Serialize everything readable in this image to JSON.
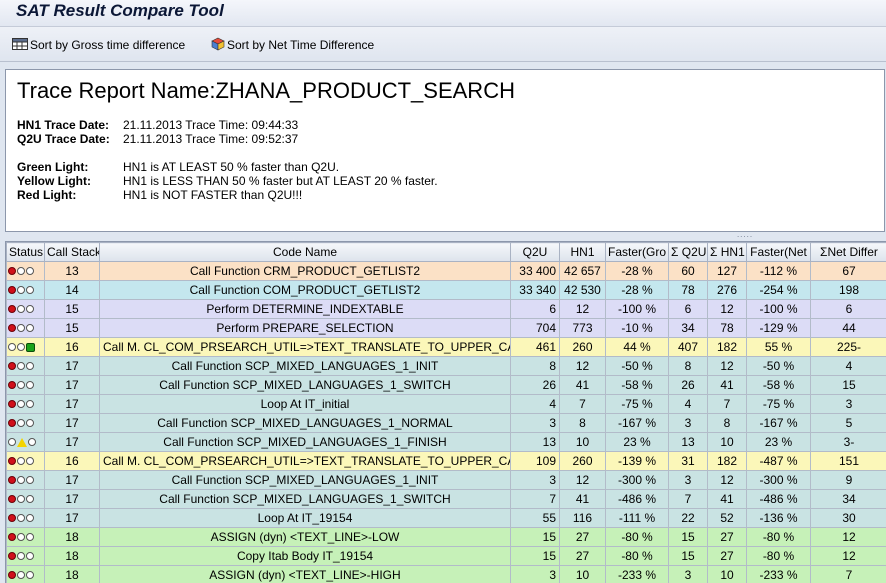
{
  "window": {
    "title": "SAT Result Compare Tool"
  },
  "toolbar": {
    "sort_gross_label": "Sort by Gross time difference",
    "sort_net_label": "Sort by Net Time Difference"
  },
  "report": {
    "name_line": "Trace Report Name:ZHANA_PRODUCT_SEARCH",
    "hn1_label": "HN1 Trace Date:",
    "hn1_value": "21.11.2013 Trace Time: 09:44:33",
    "q2u_label": "Q2U Trace Date:",
    "q2u_value": "21.11.2013 Trace Time: 09:52:37",
    "green_label": "Green Light:",
    "green_text": "HN1 is AT LEAST 50 % faster than Q2U.",
    "yellow_label": "Yellow Light:",
    "yellow_text": "HN1 is LESS THAN 50 % faster but AT LEAST 20 % faster.",
    "red_label": "Red Light:",
    "red_text": "HN1 is NOT FASTER than Q2U!!!"
  },
  "grid": {
    "columns": [
      "Status",
      "Call Stack",
      "Code Name",
      "Q2U",
      "HN1",
      "Faster(Gro",
      "Σ Q2U",
      "Σ HN1",
      "Faster(Net",
      "ΣNet Differ"
    ],
    "rows": [
      {
        "status": "red",
        "stack": "13",
        "code": "Call Function CRM_PRODUCT_GETLIST2",
        "q2u": "33 400",
        "hn1": "42 657",
        "fg": "-28 %",
        "sq2u": "60",
        "shn1": "127",
        "fn": "-112 %",
        "nd": "67",
        "bg": "peach"
      },
      {
        "status": "red",
        "stack": "14",
        "code": "Call Function COM_PRODUCT_GETLIST2",
        "q2u": "33 340",
        "hn1": "42 530",
        "fg": "-28 %",
        "sq2u": "78",
        "shn1": "276",
        "fn": "-254 %",
        "nd": "198",
        "bg": "cyan"
      },
      {
        "status": "red",
        "stack": "15",
        "code": "Perform DETERMINE_INDEXTABLE",
        "q2u": "6",
        "hn1": "12",
        "fg": "-100 %",
        "sq2u": "6",
        "shn1": "12",
        "fn": "-100 %",
        "nd": "6",
        "bg": "lav"
      },
      {
        "status": "red",
        "stack": "15",
        "code": "Perform PREPARE_SELECTION",
        "q2u": "704",
        "hn1": "773",
        "fg": "-10 %",
        "sq2u": "34",
        "shn1": "78",
        "fn": "-129 %",
        "nd": "44",
        "bg": "lav"
      },
      {
        "status": "green",
        "stack": "16",
        "code": "Call M. CL_COM_PRSEARCH_UTIL=>TEXT_TRANSLATE_TO_UPPER_CASE",
        "q2u": "461",
        "hn1": "260",
        "fg": "44 %",
        "sq2u": "407",
        "shn1": "182",
        "fn": "55 %",
        "nd": "225-",
        "bg": "yellow"
      },
      {
        "status": "red",
        "stack": "17",
        "code": "Call Function SCP_MIXED_LANGUAGES_1_INIT",
        "q2u": "8",
        "hn1": "12",
        "fg": "-50 %",
        "sq2u": "8",
        "shn1": "12",
        "fn": "-50 %",
        "nd": "4",
        "bg": "teal"
      },
      {
        "status": "red",
        "stack": "17",
        "code": "Call Function SCP_MIXED_LANGUAGES_1_SWITCH",
        "q2u": "26",
        "hn1": "41",
        "fg": "-58 %",
        "sq2u": "26",
        "shn1": "41",
        "fn": "-58 %",
        "nd": "15",
        "bg": "teal"
      },
      {
        "status": "red",
        "stack": "17",
        "code": "Loop At IT_initial",
        "q2u": "4",
        "hn1": "7",
        "fg": "-75 %",
        "sq2u": "4",
        "shn1": "7",
        "fn": "-75 %",
        "nd": "3",
        "bg": "teal"
      },
      {
        "status": "red",
        "stack": "17",
        "code": "Call Function SCP_MIXED_LANGUAGES_1_NORMAL",
        "q2u": "3",
        "hn1": "8",
        "fg": "-167 %",
        "sq2u": "3",
        "shn1": "8",
        "fn": "-167 %",
        "nd": "5",
        "bg": "teal"
      },
      {
        "status": "yellow",
        "stack": "17",
        "code": "Call Function SCP_MIXED_LANGUAGES_1_FINISH",
        "q2u": "13",
        "hn1": "10",
        "fg": "23 %",
        "sq2u": "13",
        "shn1": "10",
        "fn": "23 %",
        "nd": "3-",
        "bg": "teal"
      },
      {
        "status": "red",
        "stack": "16",
        "code": "Call M. CL_COM_PRSEARCH_UTIL=>TEXT_TRANSLATE_TO_UPPER_CASE",
        "q2u": "109",
        "hn1": "260",
        "fg": "-139 %",
        "sq2u": "31",
        "shn1": "182",
        "fn": "-487 %",
        "nd": "151",
        "bg": "yellow"
      },
      {
        "status": "red",
        "stack": "17",
        "code": "Call Function SCP_MIXED_LANGUAGES_1_INIT",
        "q2u": "3",
        "hn1": "12",
        "fg": "-300 %",
        "sq2u": "3",
        "shn1": "12",
        "fn": "-300 %",
        "nd": "9",
        "bg": "teal"
      },
      {
        "status": "red",
        "stack": "17",
        "code": "Call Function SCP_MIXED_LANGUAGES_1_SWITCH",
        "q2u": "7",
        "hn1": "41",
        "fg": "-486 %",
        "sq2u": "7",
        "shn1": "41",
        "fn": "-486 %",
        "nd": "34",
        "bg": "teal"
      },
      {
        "status": "red",
        "stack": "17",
        "code": "Loop At IT_19154",
        "q2u": "55",
        "hn1": "116",
        "fg": "-111 %",
        "sq2u": "22",
        "shn1": "52",
        "fn": "-136 %",
        "nd": "30",
        "bg": "teal"
      },
      {
        "status": "red",
        "stack": "18",
        "code": "ASSIGN (dyn) <TEXT_LINE>-LOW",
        "q2u": "15",
        "hn1": "27",
        "fg": "-80 %",
        "sq2u": "15",
        "shn1": "27",
        "fn": "-80 %",
        "nd": "12",
        "bg": "green"
      },
      {
        "status": "red",
        "stack": "18",
        "code": "Copy Itab Body IT_19154",
        "q2u": "15",
        "hn1": "27",
        "fg": "-80 %",
        "sq2u": "15",
        "shn1": "27",
        "fn": "-80 %",
        "nd": "12",
        "bg": "green"
      },
      {
        "status": "red",
        "stack": "18",
        "code": "ASSIGN (dyn) <TEXT_LINE>-HIGH",
        "q2u": "3",
        "hn1": "10",
        "fg": "-233 %",
        "sq2u": "3",
        "shn1": "10",
        "fn": "-233 %",
        "nd": "7",
        "bg": "green"
      }
    ]
  }
}
